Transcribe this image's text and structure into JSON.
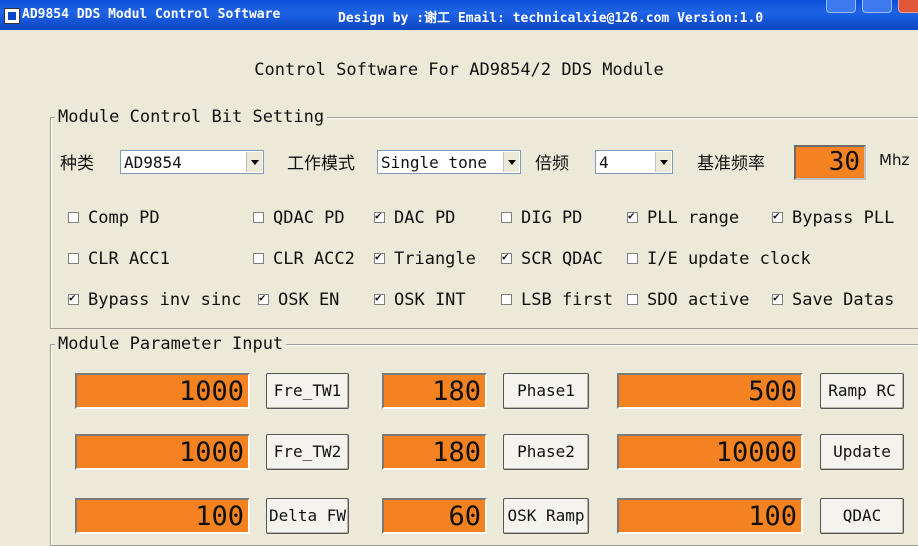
{
  "window": {
    "title": "AD9854 DDS Modul Control Software",
    "credits": "Design by :谢工  Email: technicalxie@126.com Version:1.0"
  },
  "heading": "Control Software For  AD9854/2 DDS Module",
  "control_group": {
    "title": "Module Control Bit Setting",
    "type_label": "种类",
    "type_value": "AD9854",
    "mode_label": "工作模式",
    "mode_value": "Single tone",
    "mult_label": "倍频",
    "mult_value": "4",
    "ref_label": "基准频率",
    "ref_value": "30",
    "ref_unit": "Mhz",
    "checkboxes": [
      {
        "label": "Comp PD",
        "checked": false
      },
      {
        "label": "QDAC PD",
        "checked": false
      },
      {
        "label": "DAC PD",
        "checked": true
      },
      {
        "label": "DIG PD",
        "checked": false
      },
      {
        "label": "PLL range",
        "checked": true
      },
      {
        "label": "Bypass PLL",
        "checked": true
      },
      {
        "label": "CLR ACC1",
        "checked": false
      },
      {
        "label": "CLR ACC2",
        "checked": false
      },
      {
        "label": "Triangle",
        "checked": true
      },
      {
        "label": "SCR QDAC",
        "checked": true
      },
      {
        "label": "I/E update clock",
        "checked": false
      },
      {
        "label": "Bypass inv sinc",
        "checked": true
      },
      {
        "label": "OSK EN",
        "checked": true
      },
      {
        "label": "OSK INT",
        "checked": true
      },
      {
        "label": "LSB first",
        "checked": false
      },
      {
        "label": "SDO active",
        "checked": false
      },
      {
        "label": "Save Datas",
        "checked": true
      }
    ]
  },
  "param_group": {
    "title": "Module Parameter Input",
    "rows": [
      [
        {
          "value": "1000",
          "button": "Fre_TW1"
        },
        {
          "value": "180",
          "button": "Phase1"
        },
        {
          "value": "500",
          "button": "Ramp RC"
        }
      ],
      [
        {
          "value": "1000",
          "button": "Fre_TW2"
        },
        {
          "value": "180",
          "button": "Phase2"
        },
        {
          "value": "10000",
          "button": "Update"
        }
      ],
      [
        {
          "value": "100",
          "button": "Delta FW"
        },
        {
          "value": "60",
          "button": "OSK Ramp"
        },
        {
          "value": "100",
          "button": "QDAC"
        }
      ]
    ]
  }
}
